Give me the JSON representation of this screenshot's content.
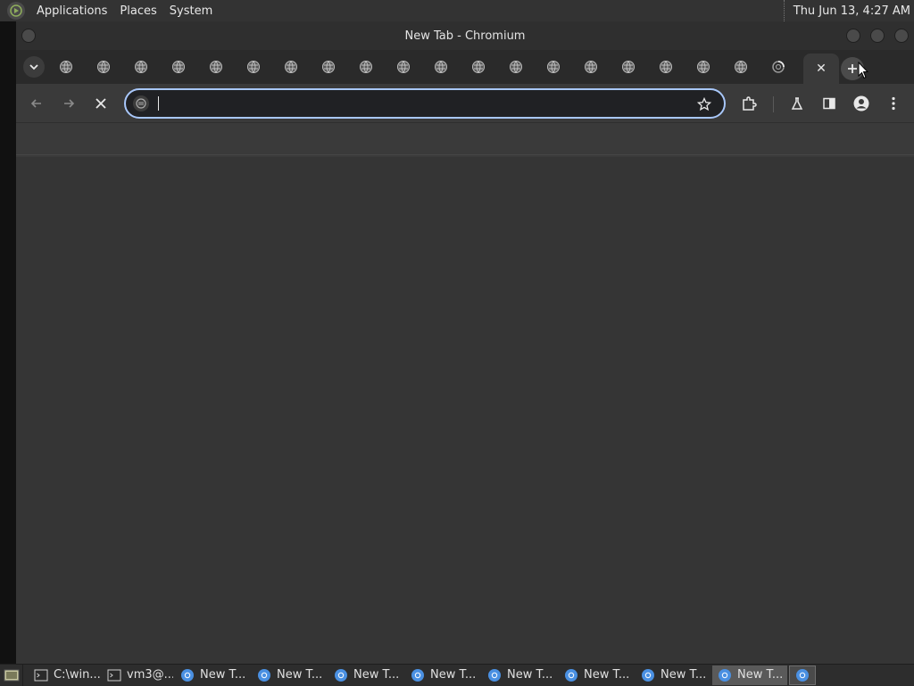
{
  "topbar": {
    "menus": [
      "Applications",
      "Places",
      "System"
    ],
    "clock": "Thu Jun 13,  4:27 AM"
  },
  "window": {
    "title": "New Tab - Chromium"
  },
  "tabs": {
    "pinned_count": 20,
    "active_close": "✕"
  },
  "omnibox": {
    "value": "",
    "placeholder": ""
  },
  "taskbar": {
    "tasks": [
      {
        "label": "C:\\win...",
        "icon": "terminal-icon"
      },
      {
        "label": "vm3@...",
        "icon": "terminal-icon"
      },
      {
        "label": "New T...",
        "icon": "chromium-icon"
      },
      {
        "label": "New T...",
        "icon": "chromium-icon"
      },
      {
        "label": "New T...",
        "icon": "chromium-icon"
      },
      {
        "label": "New T...",
        "icon": "chromium-icon"
      },
      {
        "label": "New T...",
        "icon": "chromium-icon"
      },
      {
        "label": "New T...",
        "icon": "chromium-icon"
      },
      {
        "label": "New T...",
        "icon": "chromium-icon"
      },
      {
        "label": "New T...",
        "icon": "chromium-icon"
      }
    ]
  },
  "colors": {
    "omnibox_focus": "#a8c7fa",
    "chromium_blue": "#4a90e2"
  }
}
